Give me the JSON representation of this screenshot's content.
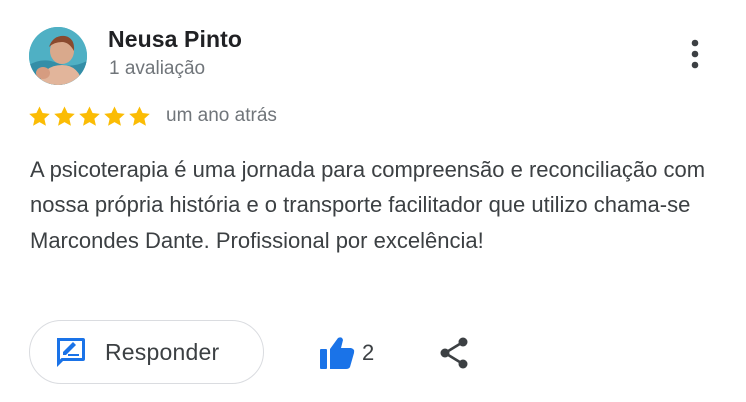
{
  "review": {
    "author": {
      "name": "Neusa Pinto",
      "subtitle": "1 avaliação",
      "avatar": "profile-photo"
    },
    "rating": 5,
    "rating_max": 5,
    "time": "um ano atrás",
    "text": "A psicoterapia é uma jornada para compreensão e reconciliação com nossa própria história e o transporte facilitador que utilizo chama-se Marcondes Dante. Profissional por excelência!"
  },
  "actions": {
    "reply_label": "Responder",
    "reply_icon": "reply-edit-icon",
    "like_icon": "thumbs-up-icon",
    "like_count": "2",
    "share_icon": "share-icon",
    "more_icon": "more-vertical-icon"
  },
  "colors": {
    "star": "#fbbc04",
    "accent_blue": "#1a73e8",
    "text_primary": "#202124",
    "text_secondary": "#70757a",
    "border": "#dadce0"
  }
}
